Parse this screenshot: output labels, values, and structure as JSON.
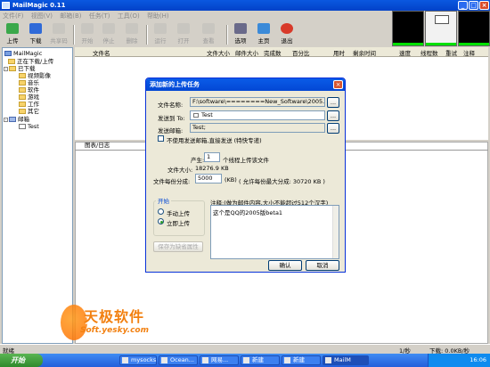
{
  "window": {
    "title": "MailMagic 0.11"
  },
  "menu": [
    "文件(F)",
    "视图(V)",
    "邮箱(B)",
    "任务(T)",
    "工具(O)",
    "帮助(H)"
  ],
  "toolbar": {
    "buttons": [
      {
        "label": "上传",
        "icon": "upload-icon",
        "enabled": true
      },
      {
        "label": "下载",
        "icon": "download-icon",
        "enabled": true
      },
      {
        "label": "共享码",
        "icon": "share-code-icon",
        "enabled": false
      },
      {
        "label": "开始",
        "icon": "start-icon",
        "enabled": false
      },
      {
        "label": "停止",
        "icon": "stop-icon",
        "enabled": false
      },
      {
        "label": "删除",
        "icon": "delete-icon",
        "enabled": false
      },
      {
        "label": "运行",
        "icon": "run-icon",
        "enabled": false
      },
      {
        "label": "打开",
        "icon": "open-icon",
        "enabled": false
      },
      {
        "label": "查看",
        "icon": "view-icon",
        "enabled": false
      },
      {
        "label": "选项",
        "icon": "options-icon",
        "enabled": true
      },
      {
        "label": "主页",
        "icon": "home-icon",
        "enabled": true
      },
      {
        "label": "退出",
        "icon": "exit-icon",
        "enabled": true
      }
    ]
  },
  "tree": {
    "root": "MailMagic",
    "items": [
      "正在下载/上传",
      "已下载",
      "视频影像",
      "音乐",
      "软件",
      "游戏",
      "工作",
      "其它",
      "邮箱",
      "Test"
    ]
  },
  "list": {
    "columns": [
      "文件名",
      "文件大小",
      "邮件大小",
      "完成数",
      "百分比",
      "用时",
      "剩余时间",
      "速度",
      "线程数",
      "重试",
      "注释"
    ]
  },
  "log": {
    "tab": "图表/日志"
  },
  "status": {
    "left": "就绪",
    "speed1": "1/秒",
    "speed2": "下载: 0.0KB/秒"
  },
  "taskbar": {
    "start": "开始",
    "tasks": [
      "mysocks",
      "Ocean...",
      "网易...",
      "新建",
      "新建",
      "MailM"
    ],
    "clock": "16:06"
  },
  "watermark": {
    "text": "天极软件",
    "sub": "Soft.yesky.com"
  },
  "dialog": {
    "title": "添加新的上传任务",
    "filename_label": "文件名称:",
    "filename_value": "F:\\software\\========New_Software\\2005.04.01\\qq20",
    "sendto_label": "发送到 To:",
    "sendto_value": "Test",
    "sendmail_label": "发送邮箱:",
    "sendmail_value": "Test;",
    "browse": "...",
    "no_forward_label": "不使用发送邮箱,直接发送 (特快专递)",
    "produce_label": "产生:",
    "threads_value": "1",
    "threads_suffix": "个线程上传该文件",
    "filesize_label": "文件大小:",
    "filesize_value": "18276.9 KB",
    "split_label": "文件每份分成:",
    "split_value": "5000",
    "split_unit": "(KB)",
    "split_note": "( 允许每份最大分成: 30720 KB )",
    "start_group": "开始",
    "manual_label": "手动上传",
    "auto_label": "立即上传",
    "save_default": "保存为缺省属性",
    "notes_label": "注释:(做为邮件内容,大小不能超过512个汉字)",
    "notes_value": "这个是QQ的2005版beta1",
    "ok": "确认",
    "cancel": "取消"
  }
}
